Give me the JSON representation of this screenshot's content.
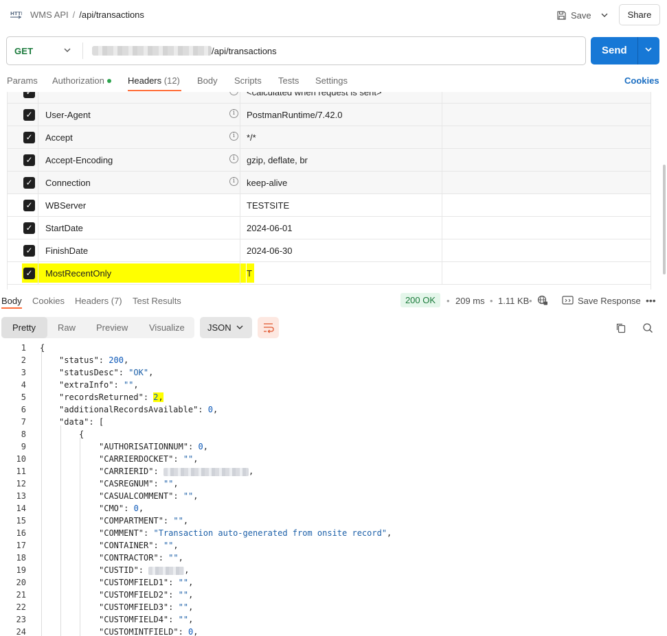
{
  "header": {
    "collection": "WMS API",
    "separator": "/",
    "request_name": "/api/transactions",
    "save_label": "Save",
    "share_label": "Share",
    "http_icon_text": "HTTP"
  },
  "url_bar": {
    "method": "GET",
    "url_suffix": "/api/transactions",
    "send_label": "Send"
  },
  "request_tabs": {
    "params": "Params",
    "authorization": "Authorization",
    "headers": "Headers",
    "headers_count": "(12)",
    "body": "Body",
    "scripts": "Scripts",
    "tests": "Tests",
    "settings": "Settings",
    "cookies": "Cookies"
  },
  "headers_table": {
    "partial_value": "<calculated when request is sent>",
    "rows": [
      {
        "key": "User-Agent",
        "value": "PostmanRuntime/7.42.0",
        "auto": true
      },
      {
        "key": "Accept",
        "value": "*/*",
        "auto": true
      },
      {
        "key": "Accept-Encoding",
        "value": "gzip, deflate, br",
        "auto": true
      },
      {
        "key": "Connection",
        "value": "keep-alive",
        "auto": true
      },
      {
        "key": "WBServer",
        "value": "TESTSITE",
        "auto": false
      },
      {
        "key": "StartDate",
        "value": "2024-06-01",
        "auto": false
      },
      {
        "key": "FinishDate",
        "value": "2024-06-30",
        "auto": false
      },
      {
        "key": "MostRecentOnly",
        "value": "T",
        "auto": false,
        "highlighted": true
      }
    ]
  },
  "response_tabs": {
    "body": "Body",
    "cookies": "Cookies",
    "headers": "Headers (7)",
    "test_results": "Test Results",
    "status": "200 OK",
    "time": "209 ms",
    "size": "1.11 KB",
    "save_response": "Save Response"
  },
  "response_toolbar": {
    "pretty": "Pretty",
    "raw": "Raw",
    "preview": "Preview",
    "visualize": "Visualize",
    "format": "JSON"
  },
  "code_lines": [
    {
      "n": "1"
    },
    {
      "n": "2"
    },
    {
      "n": "3"
    },
    {
      "n": "4"
    },
    {
      "n": "5"
    },
    {
      "n": "6"
    },
    {
      "n": "7"
    },
    {
      "n": "8"
    },
    {
      "n": "9"
    },
    {
      "n": "10"
    },
    {
      "n": "11"
    },
    {
      "n": "12"
    },
    {
      "n": "13"
    },
    {
      "n": "14"
    },
    {
      "n": "15"
    },
    {
      "n": "16"
    },
    {
      "n": "17"
    },
    {
      "n": "18"
    },
    {
      "n": "19"
    },
    {
      "n": "20"
    },
    {
      "n": "21"
    },
    {
      "n": "22"
    },
    {
      "n": "23"
    },
    {
      "n": "24"
    }
  ],
  "response_json": {
    "status": "200",
    "statusDesc": "\"OK\"",
    "extraInfo": "\"\"",
    "recordsReturned": "2",
    "additionalRecordsAvailable": "0",
    "AUTHORISATIONNUM": "0",
    "CARRIERDOCKET": "\"\"",
    "CASREGNUM": "\"\"",
    "CASUALCOMMENT": "\"\"",
    "CMO": "0",
    "COMPARTMENT": "\"\"",
    "COMMENT": "\"Transaction auto-generated from onsite record\"",
    "CONTAINER": "\"\"",
    "CONTRACTOR": "\"\"",
    "CUSTOMFIELD1": "\"\"",
    "CUSTOMFIELD2": "\"\"",
    "CUSTOMFIELD3": "\"\"",
    "CUSTOMFIELD4": "\"\"",
    "CUSTOMINTFIELD": "0"
  },
  "colors": {
    "send_button": "#1778d6",
    "method_get": "#1b7a3c",
    "active_tab_underline": "#ff6c37",
    "status_ok_bg": "#e4f6ea",
    "highlight": "#ffff00",
    "link": "#1b6ec2"
  }
}
